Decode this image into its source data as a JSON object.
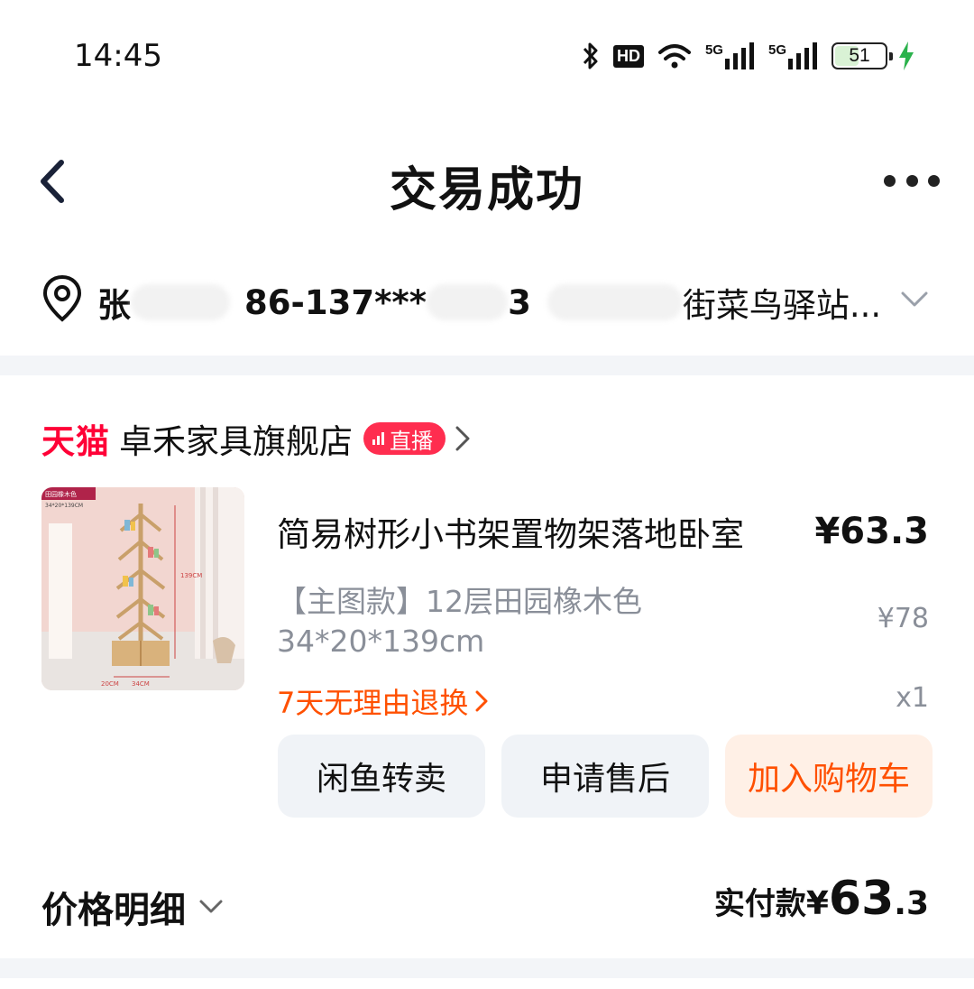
{
  "status_bar": {
    "time": "14:45",
    "hd_label": "HD",
    "net1": "5G",
    "net2": "5G",
    "battery_level": "51",
    "battery_fraction": 0.51
  },
  "nav": {
    "title": "交易成功"
  },
  "address": {
    "name_partial": "张",
    "phone": "86-137***",
    "phone_tail": "3",
    "street_partial": "街菜鸟驿站..."
  },
  "shop": {
    "platform": "天猫",
    "name": "卓禾家具旗舰店",
    "live_label": "直播"
  },
  "product": {
    "title": "简易树形小书架置物架落地卧室",
    "price": "¥63.3",
    "spec": "【主图款】12层田园橡木色34*20*139cm",
    "original_price": "¥78",
    "return_policy": "7天无理由退换",
    "quantity": "x1",
    "image_tag": "田园橡木色",
    "image_size": "34*20*139CM",
    "image_height": "139CM",
    "image_width": "34CM",
    "image_depth": "20CM"
  },
  "actions": {
    "resell": "闲鱼转卖",
    "aftersale": "申请售后",
    "add_to_cart": "加入购物车"
  },
  "price_detail": {
    "label": "价格明细",
    "paid_label": "实付款",
    "paid_currency": "¥",
    "paid_integer": "63",
    "paid_decimal": ".3"
  },
  "colors": {
    "accent_orange": "#ff5000",
    "tmall_red": "#ff0036",
    "live_badge": "#ff2d4f",
    "muted_text": "#8a8f99",
    "band_gray": "#f3f5f8"
  }
}
